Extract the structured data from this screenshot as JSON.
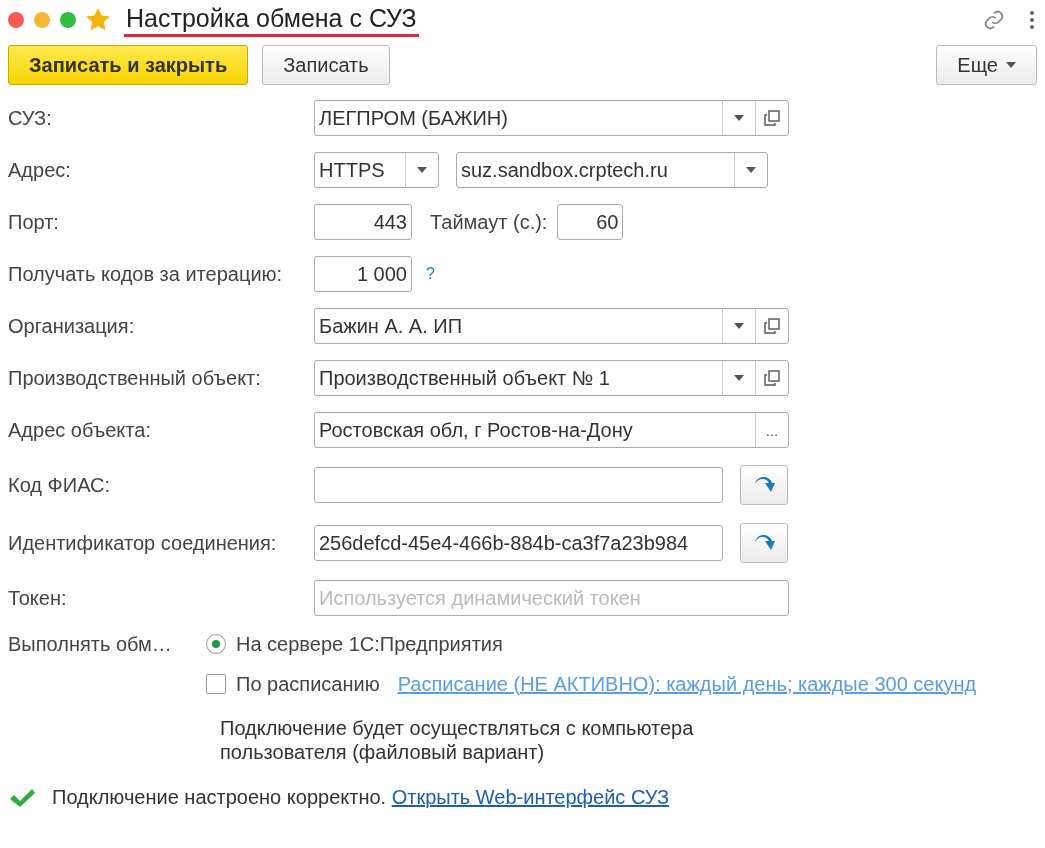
{
  "window": {
    "title": "Настройка обмена с СУЗ",
    "favorite": true
  },
  "toolbar": {
    "buttons": [
      {
        "label": "Записать и закрыть",
        "kind": "default"
      },
      {
        "label": "Записать",
        "kind": "plain"
      }
    ],
    "more": "Еще"
  },
  "fields": [
    {
      "kind": "select",
      "label": "СУЗ:",
      "value": "ЛЕГПРОМ (БАЖИН)"
    },
    {
      "kind": "address",
      "label": "Адрес:",
      "protocol": "HTTPS",
      "host": "suz.sandbox.crptech.ru"
    },
    {
      "kind": "port",
      "label": "Порт:",
      "value": "443",
      "timeout_label": "Таймаут (с.):",
      "timeout": "60"
    },
    {
      "kind": "number",
      "label": "Получать кодов за итерацию:",
      "value": "1 000",
      "help": "?"
    },
    {
      "kind": "select",
      "label": "Организация:",
      "value": "Бажин А. А. ИП"
    },
    {
      "kind": "select",
      "label": "Производственный объект:",
      "value": "Производственный объект № 1"
    },
    {
      "kind": "choice",
      "label": "Адрес объекта:",
      "value": "Ростовская обл, г Ростов-на-Дону",
      "button": "..."
    },
    {
      "kind": "fill",
      "label": "Код ФИАС:"
    },
    {
      "kind": "fill",
      "label": "Идентификатор соединения:",
      "value": "256defcd-45e4-466b-884b-ca3f7a23b984"
    },
    {
      "kind": "text",
      "label": "Токен:",
      "placeholder": "Используется динамический токен"
    }
  ],
  "exchange": {
    "label": "Выполнять обм…",
    "options": [
      {
        "kind": "radio",
        "label": "На сервере 1С:Предприятия",
        "selected": true
      },
      {
        "kind": "checkbox",
        "label": "По расписанию",
        "checked": false,
        "link": "Расписание (НЕ АКТИВНО): каждый день; каждые 300 секунд"
      }
    ],
    "note": "Подключение будет осуществляться с компьютера пользователя (файловый вариант)"
  },
  "status": {
    "ok": true,
    "text": "Подключение настроено корректно.",
    "link": "Открыть Web-интерфейс СУЗ"
  }
}
